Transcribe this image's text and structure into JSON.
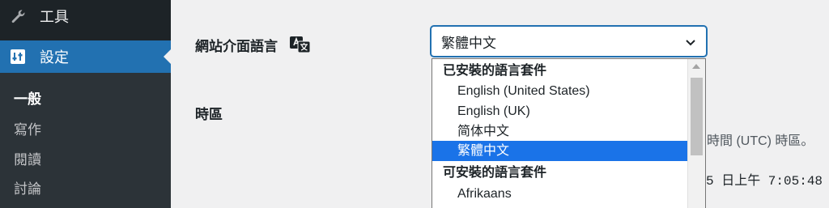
{
  "sidebar": {
    "tools_label": "工具",
    "settings_label": "設定",
    "submenu": [
      "一般",
      "寫作",
      "閱讀",
      "討論"
    ]
  },
  "settings": {
    "site_language_label": "網站介面語言",
    "timezone_label": "時區",
    "utc_note_fragment": "時間 (UTC) 時區。",
    "local_time_fragment": "5 日上午 7:05:48"
  },
  "language_select": {
    "value": "繁體中文",
    "groups": [
      {
        "label": "已安裝的語言套件",
        "options": [
          "English (United States)",
          "English (UK)",
          "简体中文",
          "繁體中文"
        ]
      },
      {
        "label": "可安裝的語言套件",
        "options": [
          "Afrikaans"
        ]
      }
    ],
    "selected_option": "繁體中文"
  },
  "colors": {
    "sidebar_bg": "#1d2327",
    "submenu_bg": "#2c3338",
    "accent": "#2271b1",
    "page_bg": "#f0f0f1",
    "highlight": "#1a73e8"
  },
  "icons": {
    "tools": "wrench-icon",
    "settings": "settings-sliders-icon",
    "translate": "translation-icon",
    "chevron": "chevron-down-icon"
  }
}
